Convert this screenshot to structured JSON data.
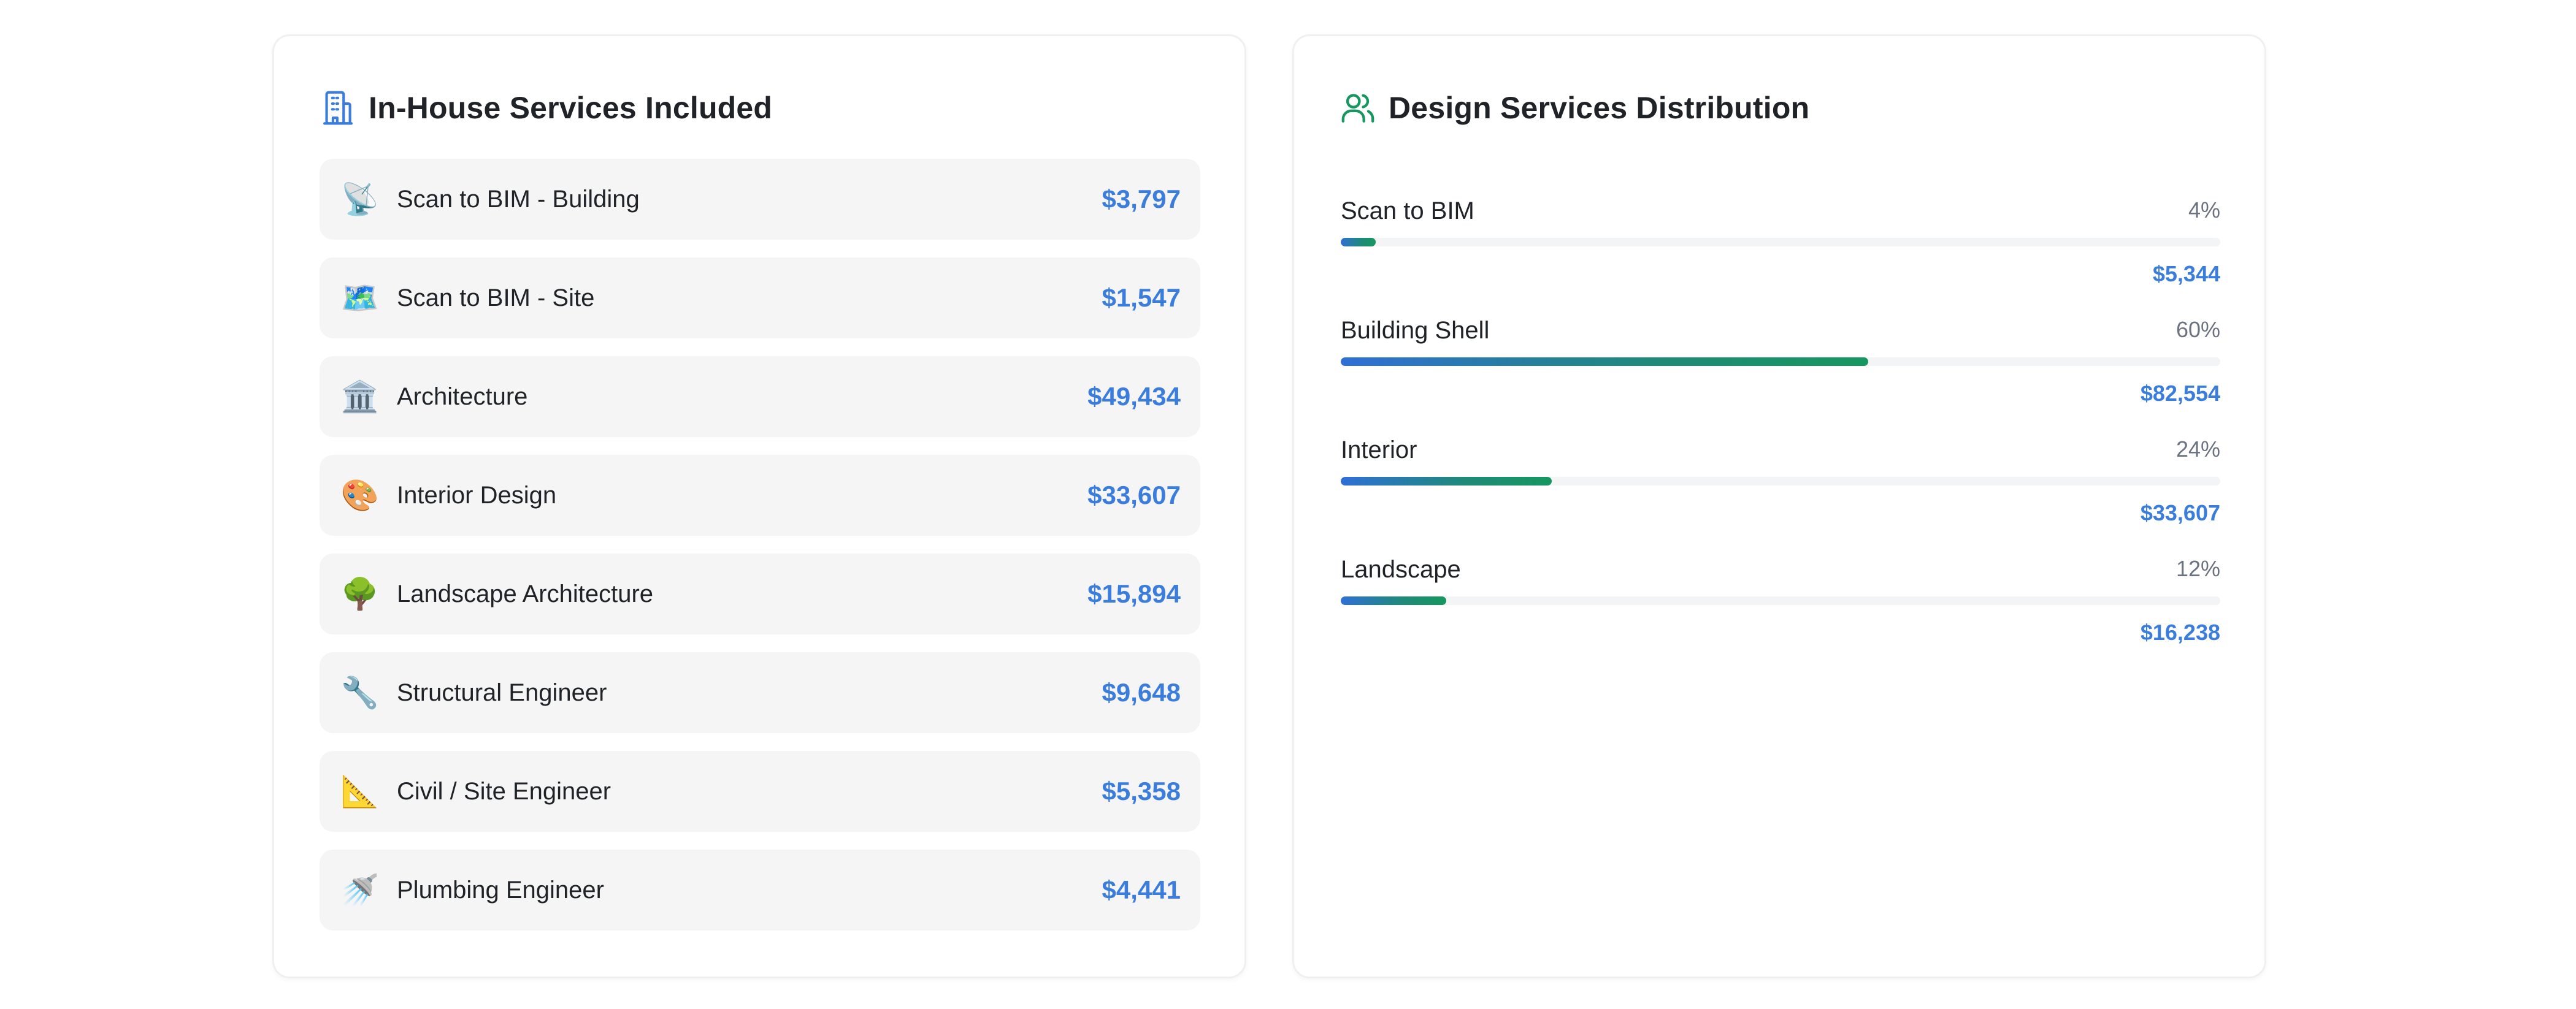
{
  "colors": {
    "accent": "#3b7ddd",
    "green": "#16975f",
    "card_border": "#eef0f2",
    "item_bg": "#f5f5f5"
  },
  "in_house": {
    "title": "In-House Services Included",
    "icon": "building-icon",
    "items": [
      {
        "icon": "satellite-dish-icon",
        "emoji": "📡",
        "name": "Scan to BIM - Building",
        "price": "$3,797"
      },
      {
        "icon": "map-icon",
        "emoji": "🗺️",
        "name": "Scan to BIM - Site",
        "price": "$1,547"
      },
      {
        "icon": "classical-building-icon",
        "emoji": "🏛️",
        "name": "Architecture",
        "price": "$49,434"
      },
      {
        "icon": "palette-icon",
        "emoji": "🎨",
        "name": "Interior Design",
        "price": "$33,607"
      },
      {
        "icon": "tree-icon",
        "emoji": "🌳",
        "name": "Landscape Architecture",
        "price": "$15,894"
      },
      {
        "icon": "wrench-icon",
        "emoji": "🔧",
        "name": "Structural Engineer",
        "price": "$9,648"
      },
      {
        "icon": "triangular-ruler-icon",
        "emoji": "📐",
        "name": "Civil / Site Engineer",
        "price": "$5,358"
      },
      {
        "icon": "shower-icon",
        "emoji": "🚿",
        "name": "Plumbing Engineer",
        "price": "$4,441"
      }
    ]
  },
  "distribution": {
    "title": "Design Services Distribution",
    "icon": "users-icon",
    "rows": [
      {
        "label": "Scan to BIM",
        "percent_label": "4%",
        "percent": 4,
        "amount": "$5,344"
      },
      {
        "label": "Building Shell",
        "percent_label": "60%",
        "percent": 60,
        "amount": "$82,554"
      },
      {
        "label": "Interior",
        "percent_label": "24%",
        "percent": 24,
        "amount": "$33,607"
      },
      {
        "label": "Landscape",
        "percent_label": "12%",
        "percent": 12,
        "amount": "$16,238"
      }
    ]
  }
}
